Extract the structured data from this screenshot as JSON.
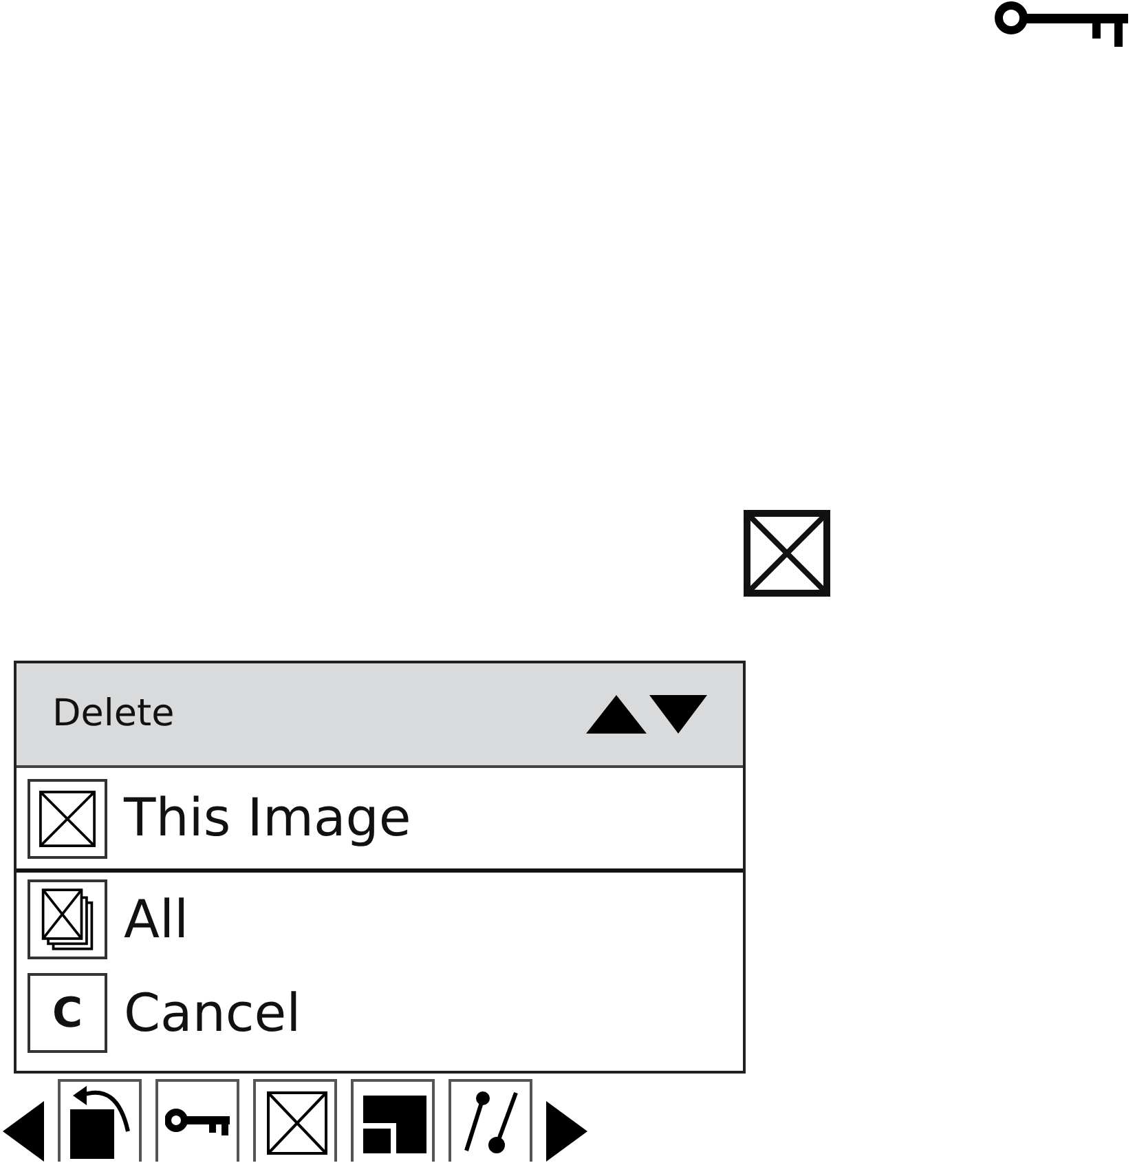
{
  "menu": {
    "title": "Delete",
    "items": [
      {
        "kind": "single",
        "label": "This Image",
        "selected": true
      },
      {
        "kind": "all",
        "label": "All",
        "selected": false
      },
      {
        "kind": "letter",
        "key_label": "C",
        "label": "Cancel",
        "selected": false
      }
    ]
  }
}
